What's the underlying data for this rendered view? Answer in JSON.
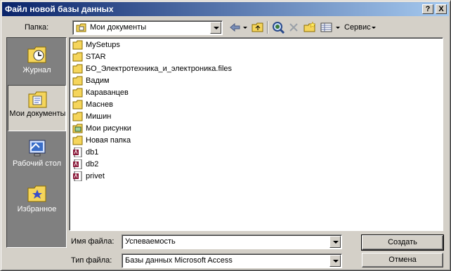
{
  "window": {
    "title": "Файл новой базы данных"
  },
  "titlebar_buttons": {
    "help": "?",
    "close": "X"
  },
  "toolbar": {
    "folder_label": "Папка:",
    "folder_value": "Мои документы",
    "tools_label": "Сервис"
  },
  "places": [
    {
      "label": "Журнал",
      "icon": "history-icon"
    },
    {
      "label": "Мои документы",
      "icon": "my-documents-icon"
    },
    {
      "label": "Рабочий стол",
      "icon": "desktop-icon"
    },
    {
      "label": "Избранное",
      "icon": "favorites-icon"
    }
  ],
  "files": [
    {
      "name": "MySetups",
      "type": "folder"
    },
    {
      "name": "STAR",
      "type": "folder"
    },
    {
      "name": "БО_Электротехника_и_электроника.files",
      "type": "folder"
    },
    {
      "name": "Вадим",
      "type": "folder"
    },
    {
      "name": "Караванцев",
      "type": "folder"
    },
    {
      "name": "Маснев",
      "type": "folder"
    },
    {
      "name": "Мишин",
      "type": "folder"
    },
    {
      "name": "Мои рисунки",
      "type": "pictures-folder"
    },
    {
      "name": "Новая папка",
      "type": "folder"
    },
    {
      "name": "db1",
      "type": "access-db"
    },
    {
      "name": "db2",
      "type": "access-db"
    },
    {
      "name": "privet",
      "type": "access-db"
    }
  ],
  "form": {
    "filename_label": "Имя файла:",
    "filename_value": "Успеваемость",
    "filetype_label": "Тип файла:",
    "filetype_value": "Базы данных Microsoft Access"
  },
  "buttons": {
    "create": "Создать",
    "cancel": "Отмена"
  },
  "colors": {
    "titlebar_start": "#0a246a",
    "titlebar_end": "#a6caf0",
    "dialog_bg": "#d4d0c8",
    "places_bg": "#808080",
    "folder_yellow": "#f5d55b"
  }
}
